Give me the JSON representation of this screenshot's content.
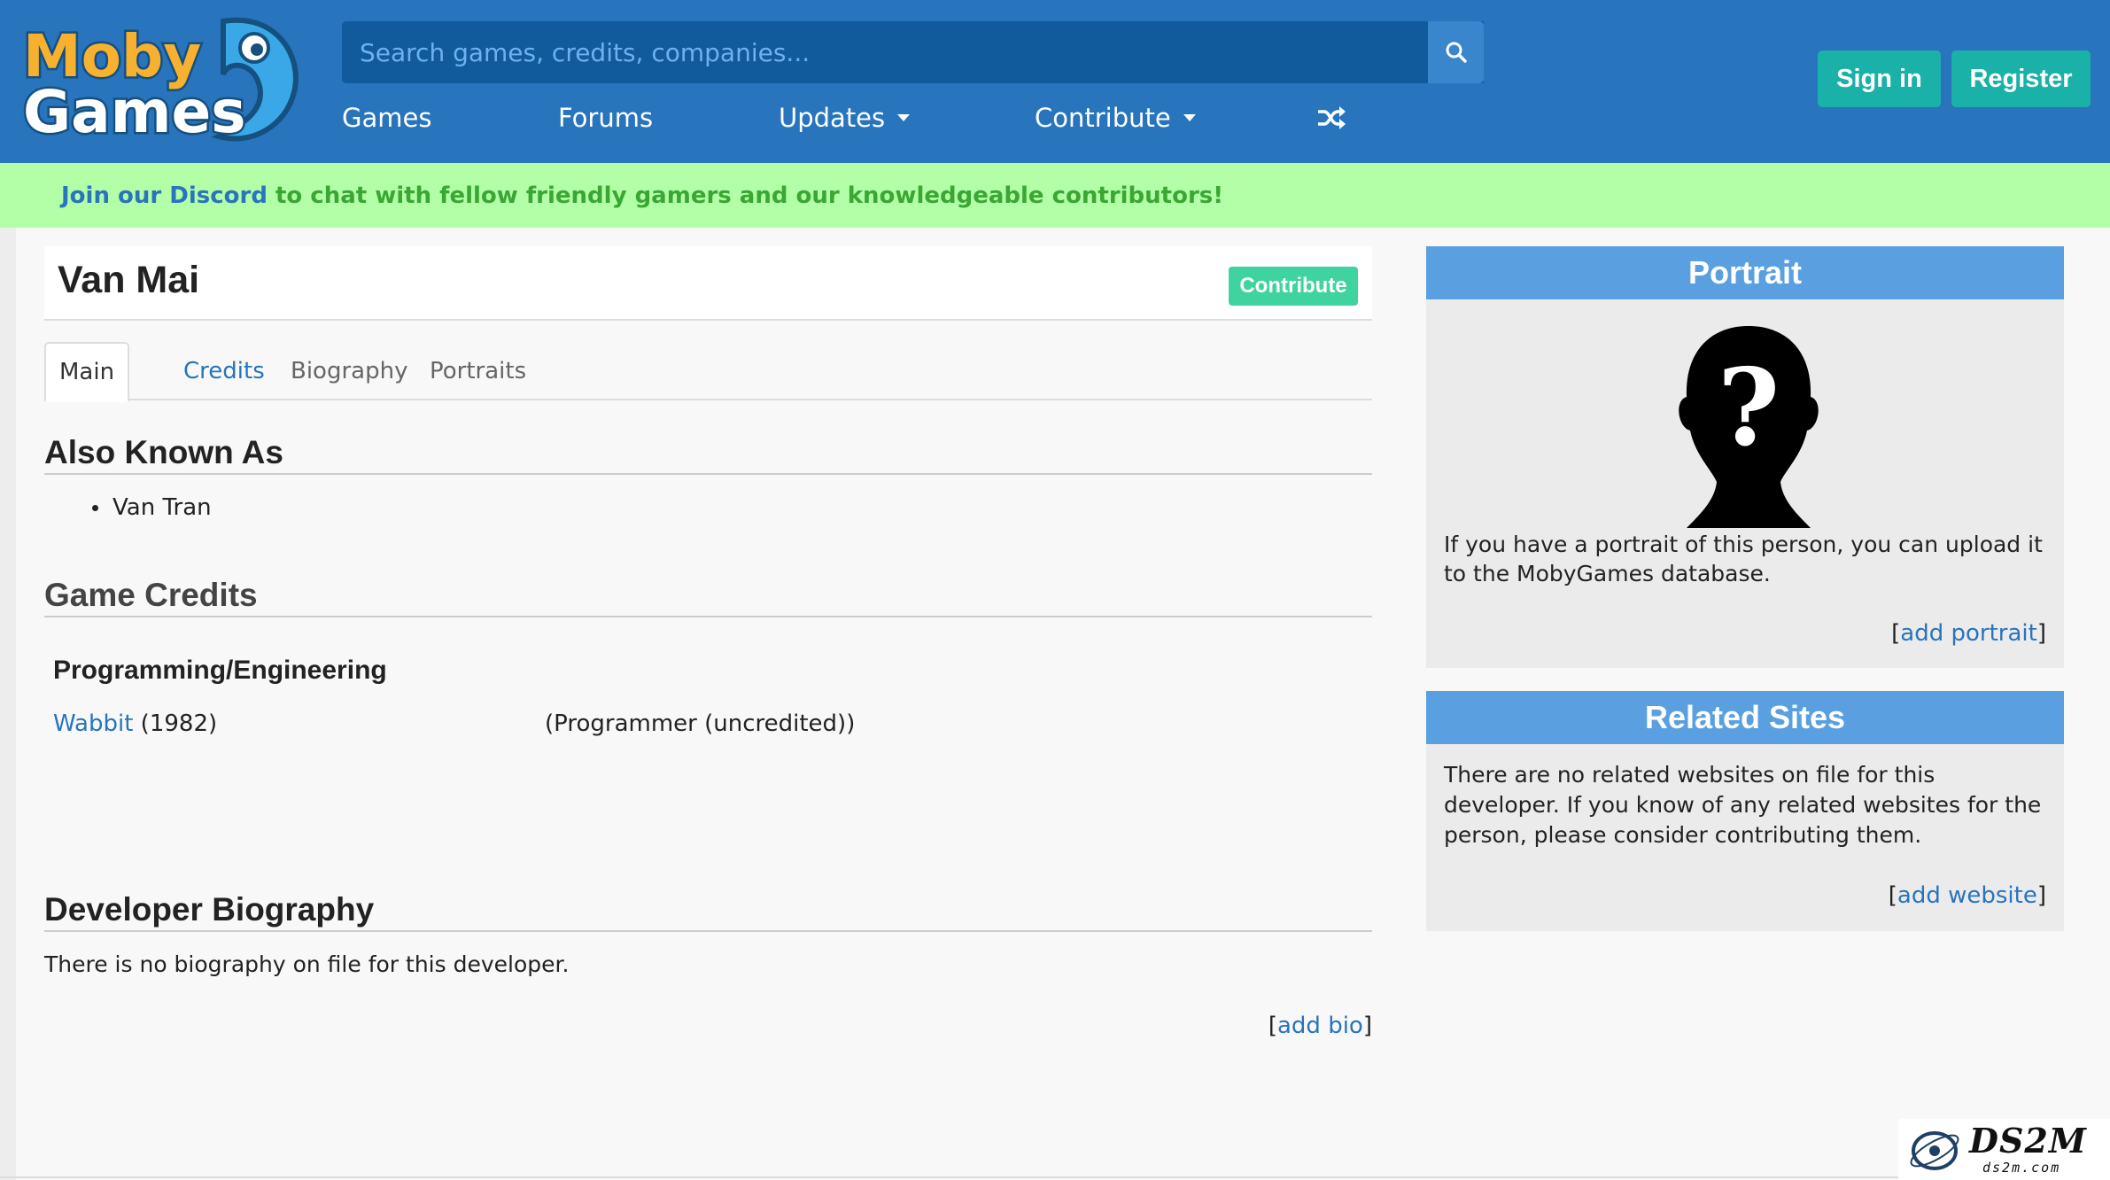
{
  "brand": {
    "logo_line1": "Moby",
    "logo_line2": "Games"
  },
  "header": {
    "search_placeholder": "Search games, credits, companies...",
    "nav": {
      "games": "Games",
      "forums": "Forums",
      "updates": "Updates",
      "contribute": "Contribute"
    },
    "sign_in": "Sign in",
    "register": "Register"
  },
  "banner": {
    "link_text": "Join our Discord",
    "rest_text": "to chat with fellow friendly gamers and our knowledgeable contributors!"
  },
  "page": {
    "title": "Van Mai",
    "contribute_label": "Contribute",
    "tabs": [
      "Main",
      "Credits",
      "Biography",
      "Portraits"
    ],
    "active_tab": "Main"
  },
  "aka": {
    "heading": "Also Known As",
    "items": [
      "Van Tran"
    ]
  },
  "credits": {
    "heading": "Game Credits",
    "role_group": "Programming/Engineering",
    "rows": [
      {
        "game": "Wabbit",
        "year": "(1982)",
        "role": "(Programmer (uncredited))"
      }
    ]
  },
  "biography": {
    "heading": "Developer Biography",
    "text": "There is no biography on file for this developer.",
    "add_link": "add bio"
  },
  "portrait": {
    "heading": "Portrait",
    "text": "If you have a portrait of this person, you can upload it to the MobyGames database.",
    "add_link": "add portrait"
  },
  "related_sites": {
    "heading": "Related Sites",
    "text": "There are no related websites on file for this developer. If you know of any related websites for the person, please consider contributing them.",
    "add_link": "add website"
  },
  "watermark": {
    "big": "DS2M",
    "small": "ds2m.com"
  },
  "colors": {
    "header_bg": "#2874bd",
    "search_bg": "#115a9c",
    "accent_teal": "#1ab1a8",
    "banner_bg": "#b3ffa8",
    "banner_text": "#3aa733",
    "link_blue": "#2874bd",
    "contribute_green": "#3fd3a0",
    "side_head": "#5aa0e0"
  },
  "icons": [
    "search-icon",
    "shuffle-icon",
    "chevron-down-icon",
    "unknown-person-icon"
  ]
}
